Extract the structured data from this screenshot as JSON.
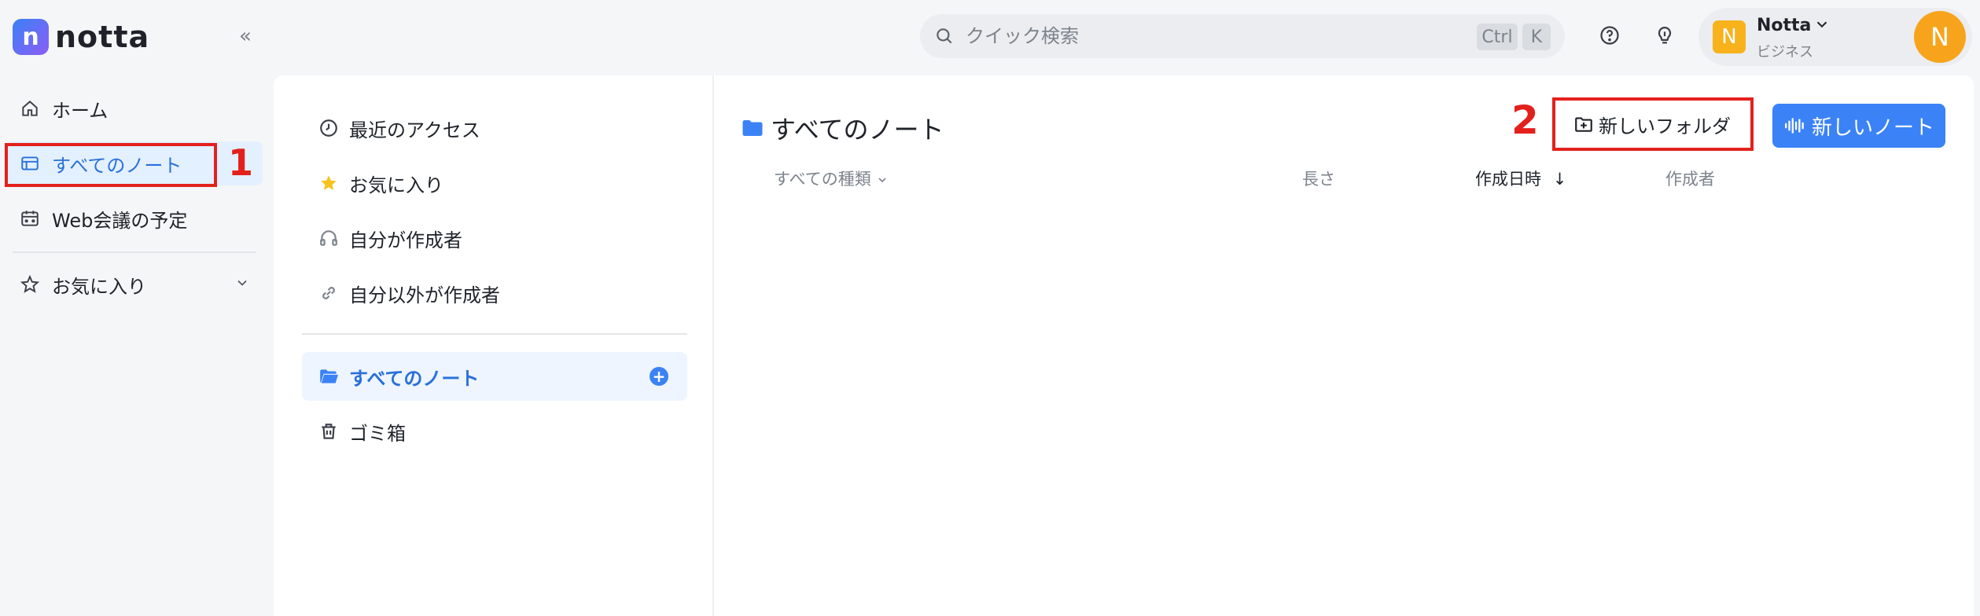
{
  "brand": {
    "logo_letter": "n",
    "name": "notta"
  },
  "sidebar": {
    "collapse_glyph": "«",
    "items": [
      {
        "label": "ホーム",
        "icon": "home-icon"
      },
      {
        "label": "すべてのノート",
        "icon": "notes-icon",
        "active": true
      },
      {
        "label": "Web会議の予定",
        "icon": "calendar-icon"
      }
    ],
    "favorites": {
      "label": "お気に入り",
      "icon": "star-outline-icon"
    }
  },
  "search": {
    "placeholder": "クイック検索",
    "shortcut_ctrl": "Ctrl",
    "shortcut_key": "K"
  },
  "account": {
    "badge": "N",
    "name": "Notta",
    "plan": "ビジネス",
    "avatar": "N"
  },
  "folders": {
    "items": [
      {
        "label": "最近のアクセス",
        "icon": "clock-icon"
      },
      {
        "label": "お気に入り",
        "icon": "star-filled-icon"
      },
      {
        "label": "自分が作成者",
        "icon": "headphones-icon"
      },
      {
        "label": "自分以外が作成者",
        "icon": "link-icon"
      }
    ],
    "all_notes": {
      "label": "すべてのノート",
      "icon": "folder-open-icon",
      "add": "+"
    },
    "trash": {
      "label": "ゴミ箱",
      "icon": "trash-icon"
    }
  },
  "content": {
    "title": "すべてのノート",
    "new_folder_label": "新しいフォルダ",
    "new_note_label": "新しいノート",
    "columns": {
      "type": "すべての種類",
      "length": "長さ",
      "created": "作成日時",
      "sort_glyph": "↓",
      "author": "作成者"
    }
  },
  "annotations": {
    "one": "1",
    "two": "2",
    "color": "#e3211c"
  },
  "colors": {
    "accent": "#3b82f6",
    "active_bg": "#e3f0ff",
    "badge": "#f7b21c"
  }
}
